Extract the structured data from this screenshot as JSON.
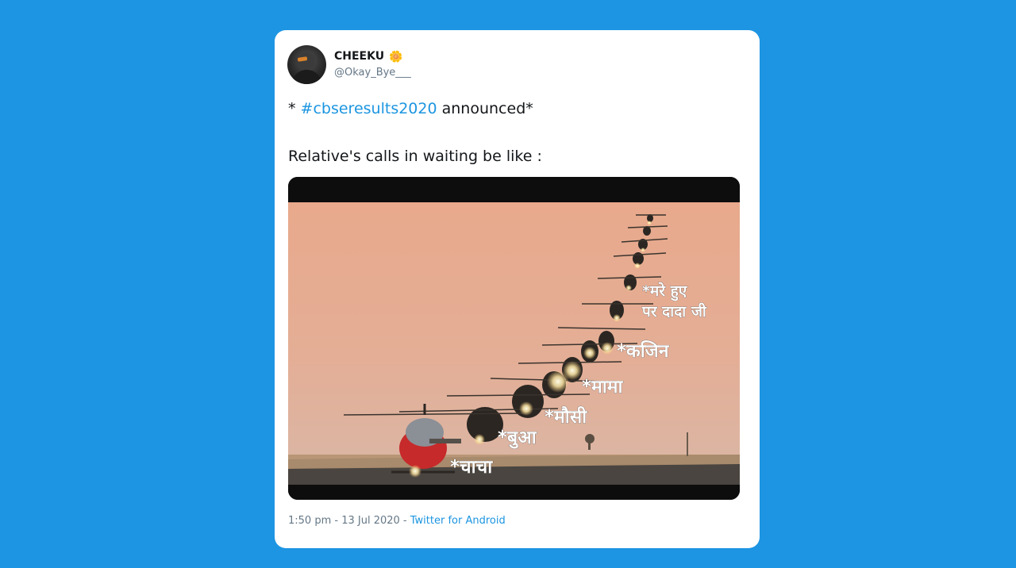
{
  "tweet": {
    "author_name": "CHEEKU",
    "verified_emoji": "🌼",
    "handle": "@Okay_Bye___",
    "text_prefix": "* ",
    "hashtag": "#cbseresults2020",
    "text_suffix": " announced*",
    "line2": "Relative's calls in waiting be like :",
    "timestamp": "1:50 pm - 13 Jul 2020",
    "separator": " - ",
    "source": "Twitter for Android"
  },
  "media": {
    "labels": {
      "chacha": "*चाचा",
      "bua": "*बुआ",
      "mausi": "*मौसी",
      "mama": "*मामा",
      "cousin": "*कजिन",
      "dead_line1": "*मरे हुए",
      "dead_line2": "पर दादा जी"
    }
  },
  "colors": {
    "background": "#1d95e3",
    "link": "#1b95e0",
    "secondary_text": "#657786"
  }
}
